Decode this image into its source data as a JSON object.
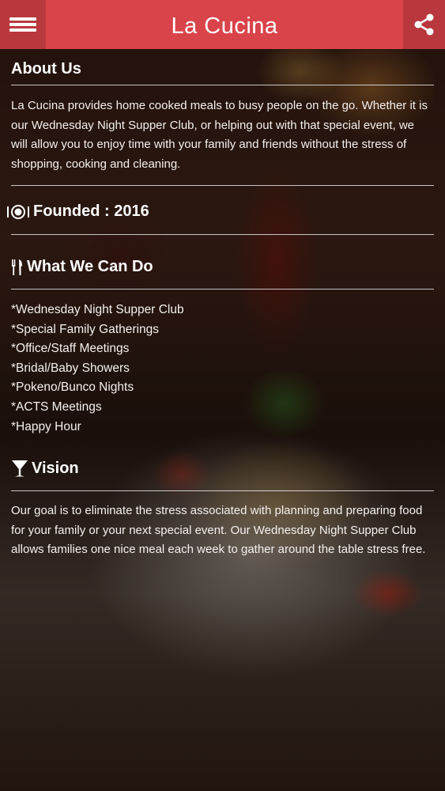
{
  "header": {
    "title": "La Cucina",
    "menu_icon": "hamburger-menu-icon",
    "share_icon": "share-icon",
    "bar_color": "#d9434a",
    "button_color": "#b9383d"
  },
  "about": {
    "heading": "About Us",
    "body": "La Cucina provides home cooked meals to busy people on the go. Whether it is our Wednesday Night Supper Club, or helping out with that special event, we will allow you to enjoy time with your family and friends without the stress of shopping, cooking and cleaning."
  },
  "founded": {
    "icon": "plate-icon",
    "label": "Founded : 2016"
  },
  "services": {
    "icon": "utensils-icon",
    "heading": "What We Can Do",
    "items": [
      "*Wednesday Night Supper Club",
      "*Special Family Gatherings",
      "*Office/Staff Meetings",
      "*Bridal/Baby Showers",
      "*Pokeno/Bunco Nights",
      "*ACTS Meetings",
      "*Happy Hour"
    ]
  },
  "vision": {
    "icon": "cocktail-glass-icon",
    "heading": "Vision",
    "body": "Our goal is to eliminate the stress associated with planning and preparing food for your family or your next special event. Our Wednesday Night Supper Club allows families one nice meal each week to gather around the table stress free."
  }
}
